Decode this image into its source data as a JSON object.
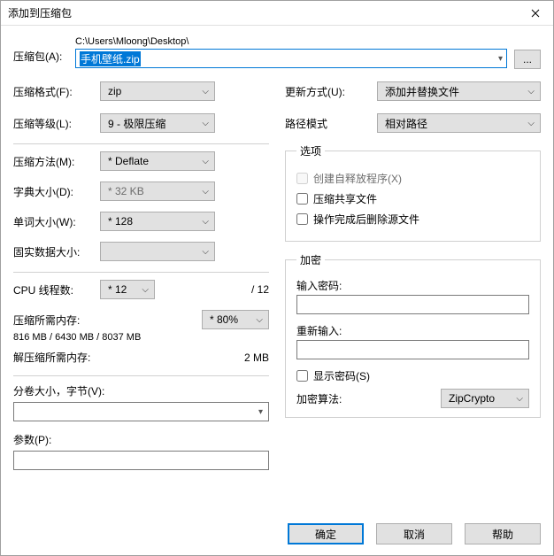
{
  "title": "添加到压缩包",
  "archive": {
    "label": "压缩包(A):",
    "path": "C:\\Users\\Mloong\\Desktop\\",
    "filename": "手机壁纸.zip",
    "browse": "..."
  },
  "left": {
    "format_label": "压缩格式(F):",
    "format_value": "zip",
    "level_label": "压缩等级(L):",
    "level_value": "9 - 极限压缩",
    "method_label": "压缩方法(M):",
    "method_value": "* Deflate",
    "dict_label": "字典大小(D):",
    "dict_value": "* 32 KB",
    "word_label": "单词大小(W):",
    "word_value": "* 128",
    "solid_label": "固实数据大小:",
    "threads_label": "CPU 线程数:",
    "threads_value": "* 12",
    "threads_total": "/ 12",
    "compress_mem_label": "压缩所需内存:",
    "compress_mem_value": "816 MB / 6430 MB / 8037 MB",
    "compress_mem_pct": "* 80%",
    "decompress_mem_label": "解压缩所需内存:",
    "decompress_mem_value": "2 MB",
    "split_label": "分卷大小，字节(V):",
    "params_label": "参数(P):"
  },
  "right": {
    "update_label": "更新方式(U):",
    "update_value": "添加并替换文件",
    "path_label": "路径模式",
    "path_value": "相对路径",
    "options_legend": "选项",
    "sfx_label": "创建自释放程序(X)",
    "shared_label": "压缩共享文件",
    "delete_label": "操作完成后删除源文件",
    "encrypt_legend": "加密",
    "pw_label": "输入密码:",
    "pw2_label": "重新输入:",
    "showpw_label": "显示密码(S)",
    "algo_label": "加密算法:",
    "algo_value": "ZipCrypto"
  },
  "buttons": {
    "ok": "确定",
    "cancel": "取消",
    "help": "帮助"
  }
}
